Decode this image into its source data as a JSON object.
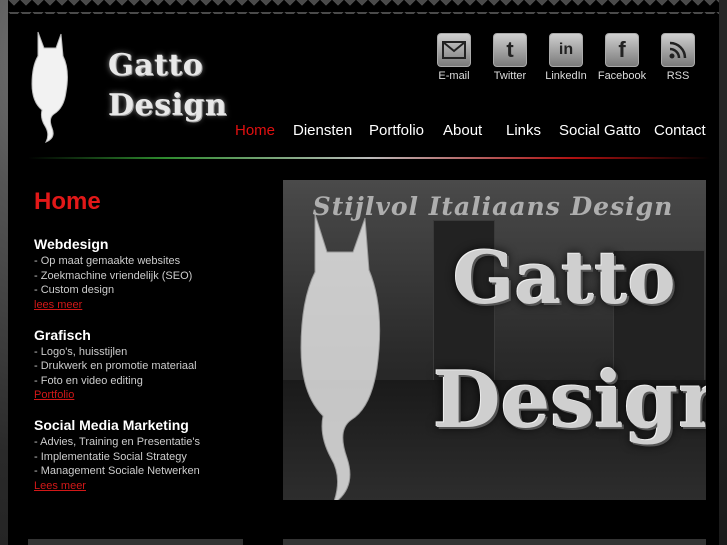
{
  "brand": {
    "line1": "Gatto",
    "line2": "Design"
  },
  "social": [
    {
      "icon": "email-icon",
      "label": "E-mail"
    },
    {
      "icon": "twitter-icon",
      "label": "Twitter"
    },
    {
      "icon": "linkedin-icon",
      "label": "LinkedIn"
    },
    {
      "icon": "facebook-icon",
      "label": "Facebook"
    },
    {
      "icon": "rss-icon",
      "label": "RSS"
    }
  ],
  "nav": [
    "Home",
    "Diensten",
    "Portfolio",
    "About",
    "Links",
    "Social Gatto",
    "Contact"
  ],
  "nav_active": "Home",
  "content": {
    "heading": "Home",
    "sections": [
      {
        "title": "Webdesign",
        "bullets": [
          "- Op maat gemaakte websites",
          "- Zoekmachine vriendelijk (SEO)",
          "- Custom design"
        ],
        "link": "lees meer"
      },
      {
        "title": "Grafisch",
        "bullets": [
          "- Logo's, huisstijlen",
          "- Drukwerk en promotie materiaal",
          "- Foto en video editing"
        ],
        "link": "Portfolio"
      },
      {
        "title": "Social Media Marketing",
        "bullets": [
          "- Advies, Training en Presentatie's",
          "- Implementatie Social Strategy",
          "- Management Sociale Netwerken"
        ],
        "link": "Lees meer"
      }
    ]
  },
  "hero": {
    "tagline": "Stijlvol Italiaans Design",
    "word1": "Gatto",
    "word2": "Design"
  },
  "colors": {
    "accent": "#e01010",
    "background": "#000000"
  }
}
